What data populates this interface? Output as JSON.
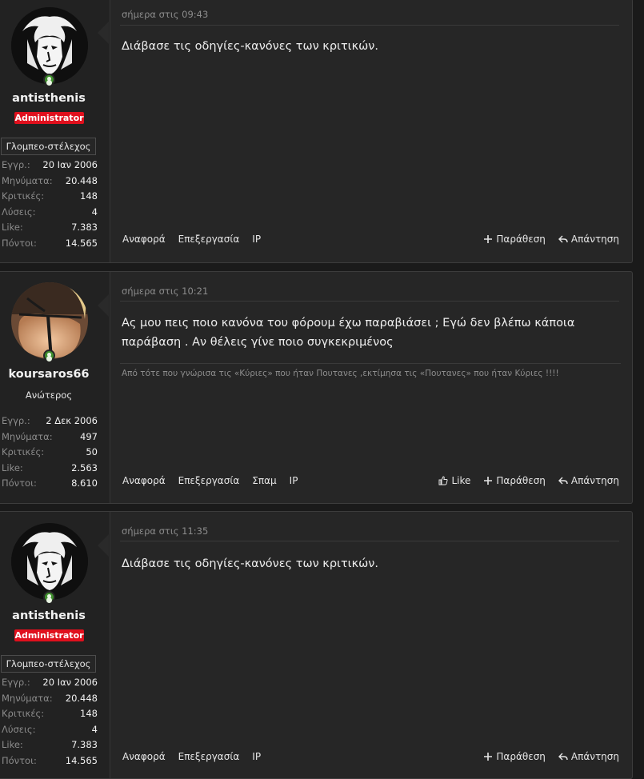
{
  "posts": [
    {
      "username": "antisthenis",
      "badge": "Administrator",
      "banner": "Γλομπεο-στέλεχος",
      "stats": [
        {
          "k": "Εγγρ.:",
          "v": "20 Ιαν 2006"
        },
        {
          "k": "Μηνύματα:",
          "v": "20.448"
        },
        {
          "k": "Κριτικές:",
          "v": "148"
        },
        {
          "k": "Λύσεις:",
          "v": "4"
        },
        {
          "k": "Like:",
          "v": "7.383"
        },
        {
          "k": "Πόντοι:",
          "v": "14.565"
        }
      ],
      "time": "σήμερα στις 09:43",
      "body": "Διάβασε τις οδηγίες-κανόνες των κριτικών.",
      "actions_left": [
        "Αναφορά",
        "Επεξεργασία",
        "IP"
      ],
      "quote": "Παράθεση",
      "reply": "Απάντηση"
    },
    {
      "username": "koursaros66",
      "title": "Ανώτερος",
      "stats": [
        {
          "k": "Εγγρ.:",
          "v": "2 Δεκ 2006"
        },
        {
          "k": "Μηνύματα:",
          "v": "497"
        },
        {
          "k": "Κριτικές:",
          "v": "50"
        },
        {
          "k": "Like:",
          "v": "2.563"
        },
        {
          "k": "Πόντοι:",
          "v": "8.610"
        }
      ],
      "time": "σήμερα στις 10:21",
      "body": "Ας μου πεις ποιο κανόνα του φόρουμ έχω παραβιάσει ; Εγώ δεν βλέπω κάποια παράβαση . Αν θέλεις γίνε ποιο συγκεκριμένος",
      "signature": "Από τότε που γνώρισα τις «Κύριες» που ήταν Πουτανες ,εκτίμησα τις «Πουτανες» που ήταν Κύριες !!!!",
      "actions_left": [
        "Αναφορά",
        "Επεξεργασία",
        "Σπαμ",
        "IP"
      ],
      "like": "Like",
      "quote": "Παράθεση",
      "reply": "Απάντηση"
    },
    {
      "username": "antisthenis",
      "badge": "Administrator",
      "banner": "Γλομπεο-στέλεχος",
      "stats": [
        {
          "k": "Εγγρ.:",
          "v": "20 Ιαν 2006"
        },
        {
          "k": "Μηνύματα:",
          "v": "20.448"
        },
        {
          "k": "Κριτικές:",
          "v": "148"
        },
        {
          "k": "Λύσεις:",
          "v": "4"
        },
        {
          "k": "Like:",
          "v": "7.383"
        },
        {
          "k": "Πόντοι:",
          "v": "14.565"
        }
      ],
      "time": "σήμερα στις 11:35",
      "body": "Διάβασε τις οδηγίες-κανόνες των κριτικών.",
      "actions_left": [
        "Αναφορά",
        "Επεξεργασία",
        "IP"
      ],
      "quote": "Παράθεση",
      "reply": "Απάντηση"
    }
  ],
  "icons": {
    "online": "user-online-icon",
    "like": "thumbs-up-icon",
    "quote": "plus-icon",
    "reply": "reply-arrow-icon"
  }
}
